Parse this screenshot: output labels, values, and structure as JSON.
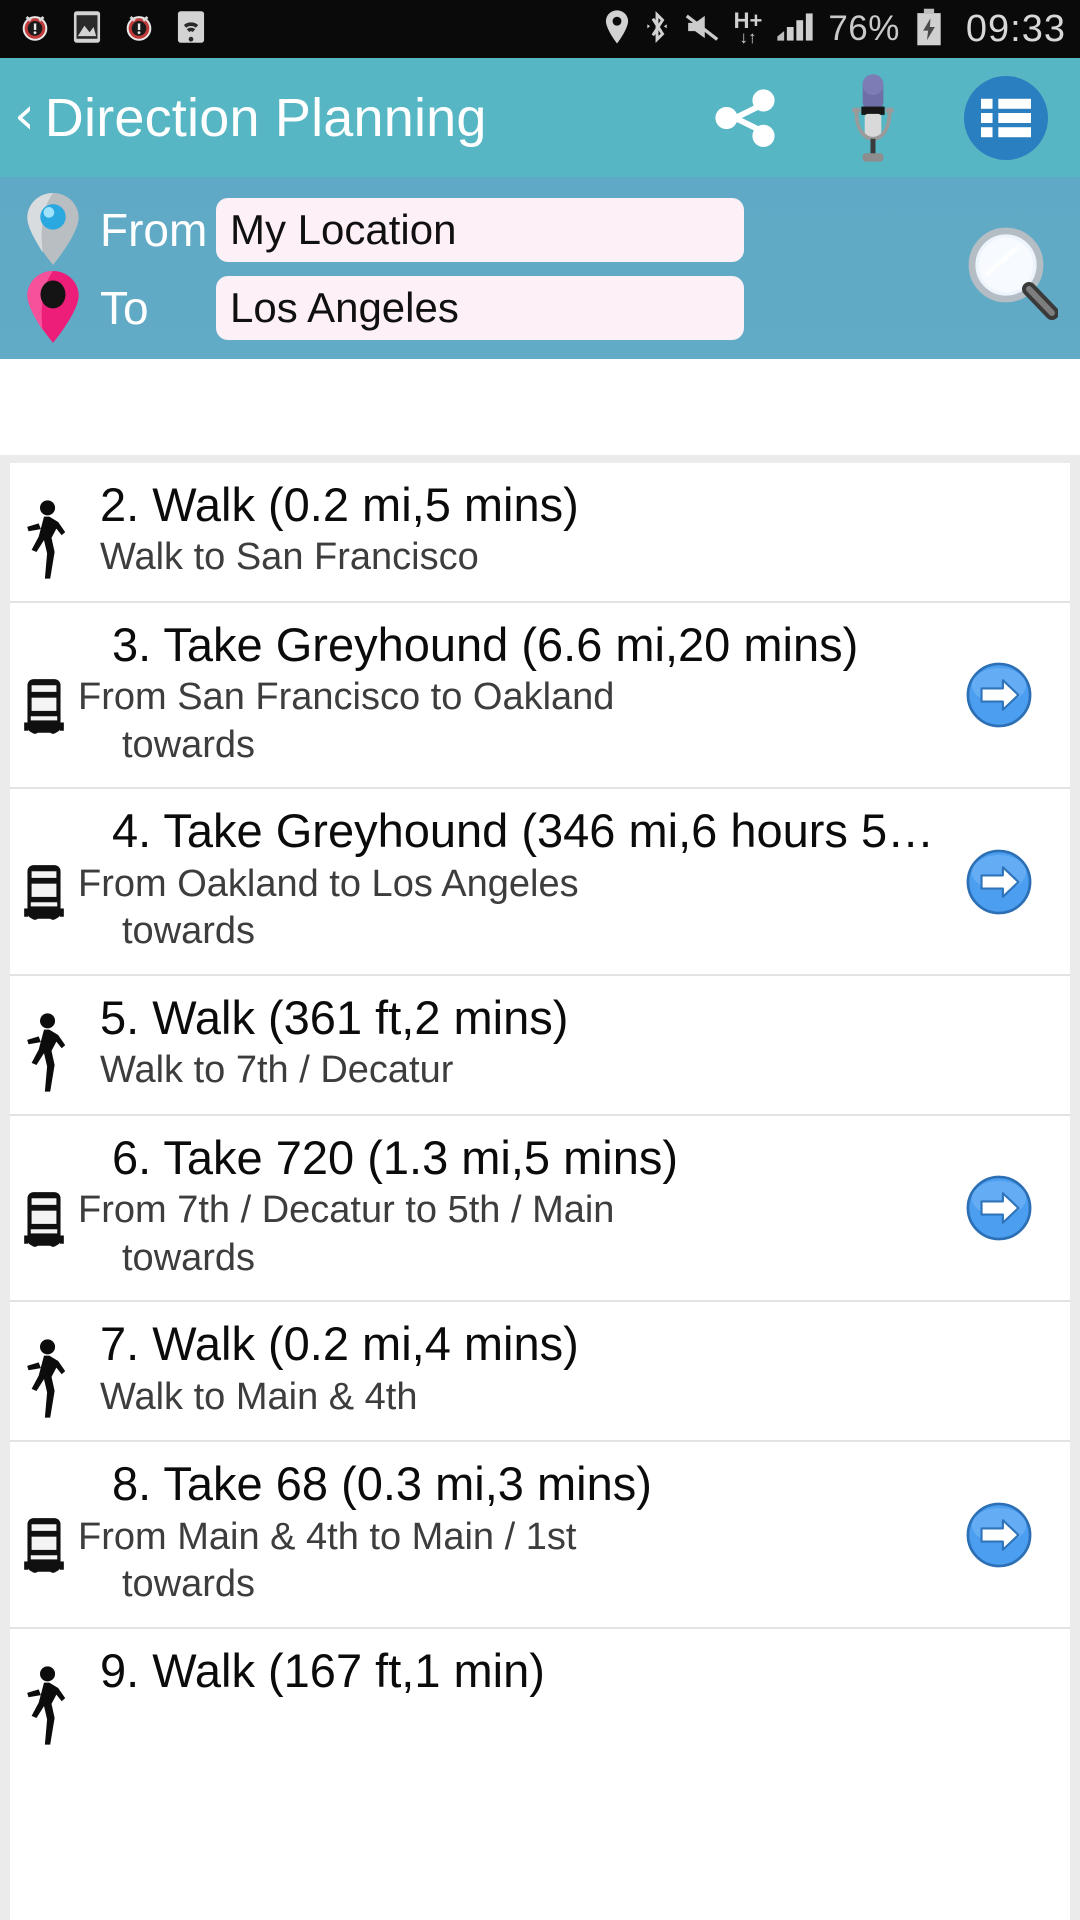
{
  "status_bar": {
    "left_icons": [
      "alarm-icon",
      "image-icon",
      "alarm-icon",
      "wifi-icon"
    ],
    "right_icons": [
      "location-icon",
      "bluetooth-icon",
      "mute-icon",
      "hplus-data-icon",
      "signal-icon"
    ],
    "network_type": "H+",
    "battery_percent": "76%",
    "battery_state": "charging",
    "clock": "09:33"
  },
  "header": {
    "back_label": "‹",
    "title": "Direction Planning",
    "share_icon": "share-icon",
    "mic_icon": "microphone-icon",
    "list_icon": "list-icon"
  },
  "route": {
    "from_label": "From",
    "from_value": "My Location",
    "from_placeholder": "From",
    "to_label": "To",
    "to_value": "Los Angeles",
    "to_placeholder": "To",
    "search_icon": "magnifier-icon"
  },
  "steps": [
    {
      "title": "2. Walk (0.2 mi,5 mins)",
      "subtitle": "Walk to San Francisco",
      "towards": "",
      "icon": "walk-icon",
      "type": "walk",
      "has_go": false
    },
    {
      "title": "3. Take Greyhound (6.6 mi,20 mins)",
      "subtitle": "From San Francisco to Oakland",
      "towards": "towards",
      "icon": "bus-icon",
      "type": "transit",
      "has_go": true
    },
    {
      "title": "4. Take Greyhound (346 mi,6 hours 5…",
      "subtitle": "From Oakland to Los Angeles",
      "towards": "towards",
      "icon": "bus-icon",
      "type": "transit",
      "has_go": true
    },
    {
      "title": "5. Walk (361 ft,2 mins)",
      "subtitle": "Walk to 7th / Decatur",
      "towards": "",
      "icon": "walk-icon",
      "type": "walk",
      "has_go": false
    },
    {
      "title": "6. Take 720 (1.3 mi,5 mins)",
      "subtitle": "From 7th / Decatur to 5th / Main",
      "towards": "towards",
      "icon": "bus-icon",
      "type": "transit",
      "has_go": true
    },
    {
      "title": "7. Walk (0.2 mi,4 mins)",
      "subtitle": "Walk to Main & 4th",
      "towards": "",
      "icon": "walk-icon",
      "type": "walk",
      "has_go": false
    },
    {
      "title": "8. Take 68 (0.3 mi,3 mins)",
      "subtitle": "From Main & 4th to Main / 1st",
      "towards": "towards",
      "icon": "bus-icon",
      "type": "transit",
      "has_go": true
    },
    {
      "title": "9. Walk (167 ft,1 min)",
      "subtitle": "",
      "towards": "",
      "icon": "walk-icon",
      "type": "walk",
      "has_go": false
    }
  ],
  "colors": {
    "appbar": "#56b6c4",
    "panel": "#5fa9c6",
    "field": "#fdf0f7",
    "accent_blue": "#2a7fc0",
    "status_bar": "#0a0a0a",
    "to_pin": "#ed1e79"
  }
}
